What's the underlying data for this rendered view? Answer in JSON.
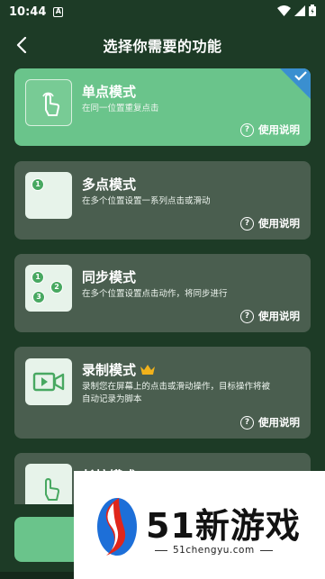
{
  "status_bar": {
    "time": "10:44",
    "a_glyph": "A"
  },
  "header": {
    "title": "选择你需要的功能"
  },
  "cards": [
    {
      "title": "单点模式",
      "desc": "在同一位置重复点击",
      "help": "使用说明",
      "selected": true
    },
    {
      "title": "多点模式",
      "desc": "在多个位置设置一系列点击或滑动",
      "help": "使用说明",
      "dot_labels": [
        "1"
      ]
    },
    {
      "title": "同步模式",
      "desc": "在多个位置设置点击动作，将同步进行",
      "help": "使用说明",
      "dot_labels": [
        "1",
        "2",
        "3"
      ]
    },
    {
      "title": "录制模式",
      "desc": "录制您在屏幕上的点击或滑动操作，目标操作将被自动记录为脚本",
      "help": "使用说明"
    },
    {
      "title": "长按模式"
    }
  ],
  "help_glyph": "?",
  "ad": {
    "brand": "51新游戏",
    "url": "51chengyu.com"
  },
  "colors": {
    "background": "#1d3b26",
    "card": "#4a5e4f",
    "selected": "#6ac48b",
    "check": "#3a8fd0"
  },
  "icons": [
    "back-arrow-icon",
    "wifi-icon",
    "signal-icon",
    "battery-icon",
    "tap-hand-icon",
    "video-record-icon",
    "crown-icon",
    "checkmark-icon",
    "help-icon"
  ]
}
